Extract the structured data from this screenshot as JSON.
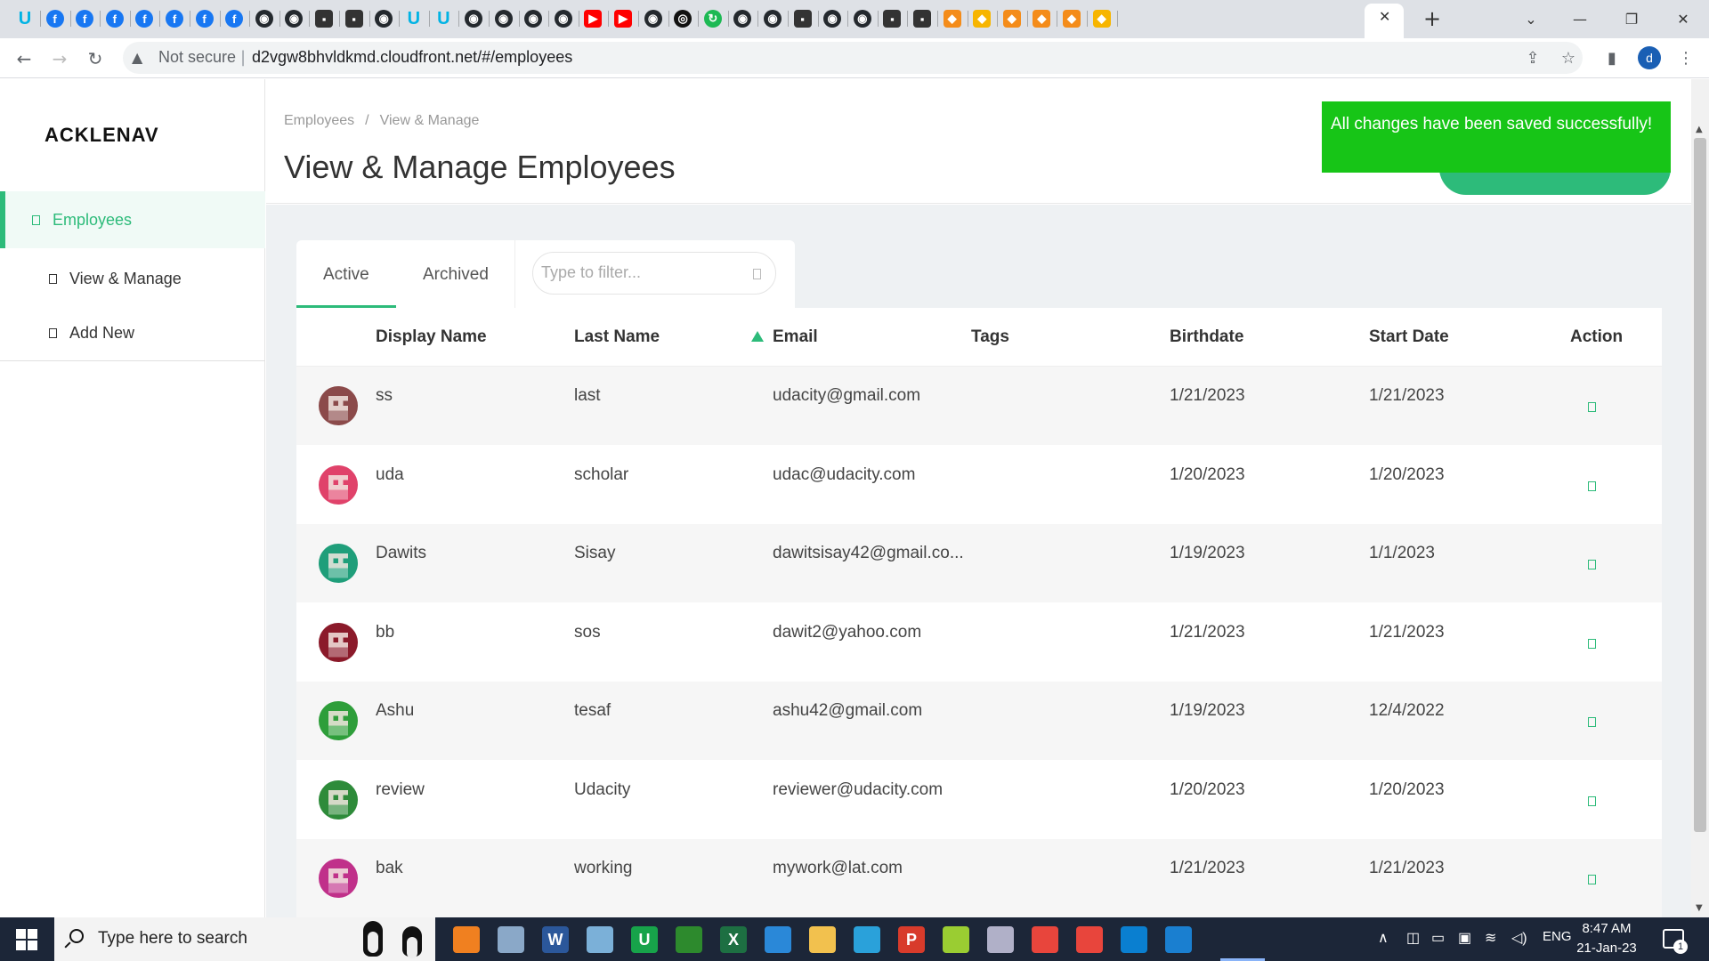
{
  "browser": {
    "address_warning": "Not secure",
    "url": "d2vgw8bhvldkmd.cloudfront.net/#/employees",
    "profile_initial": "d",
    "new_tab_label": "+",
    "close_tab_label": "✕",
    "pinned_tabs": [
      {
        "icon": "udacity-icon",
        "color": "#02b3e4"
      },
      {
        "icon": "facebook-icon",
        "color": "#1877f2"
      },
      {
        "icon": "facebook-icon",
        "color": "#1877f2"
      },
      {
        "icon": "facebook-icon",
        "color": "#1877f2"
      },
      {
        "icon": "facebook-icon",
        "color": "#1877f2"
      },
      {
        "icon": "facebook-icon",
        "color": "#1877f2"
      },
      {
        "icon": "facebook-icon",
        "color": "#1877f2"
      },
      {
        "icon": "facebook-icon",
        "color": "#1877f2"
      },
      {
        "icon": "github-icon",
        "color": "#24292e"
      },
      {
        "icon": "github-icon",
        "color": "#24292e"
      },
      {
        "icon": "terminal-icon",
        "color": "#333333"
      },
      {
        "icon": "terminal-icon",
        "color": "#333333"
      },
      {
        "icon": "github-icon",
        "color": "#24292e"
      },
      {
        "icon": "udacity-icon",
        "color": "#02b3e4"
      },
      {
        "icon": "udacity-icon",
        "color": "#02b3e4"
      },
      {
        "icon": "github-icon",
        "color": "#24292e"
      },
      {
        "icon": "github-icon",
        "color": "#24292e"
      },
      {
        "icon": "github-icon",
        "color": "#24292e"
      },
      {
        "icon": "github-icon",
        "color": "#24292e"
      },
      {
        "icon": "youtube-icon",
        "color": "#ff0000"
      },
      {
        "icon": "youtube-icon",
        "color": "#ff0000"
      },
      {
        "icon": "github-icon",
        "color": "#24292e"
      },
      {
        "icon": "circle-logo-icon",
        "color": "#111111"
      },
      {
        "icon": "green-circle-icon",
        "color": "#1db954"
      },
      {
        "icon": "github-icon",
        "color": "#24292e"
      },
      {
        "icon": "github-icon",
        "color": "#24292e"
      },
      {
        "icon": "terminal-icon",
        "color": "#333333"
      },
      {
        "icon": "github-icon",
        "color": "#24292e"
      },
      {
        "icon": "github-icon",
        "color": "#24292e"
      },
      {
        "icon": "terminal-icon",
        "color": "#333333"
      },
      {
        "icon": "terminal-icon",
        "color": "#333333"
      },
      {
        "icon": "aws-cube-icon",
        "color": "#f48c1a"
      },
      {
        "icon": "aws-box-icon",
        "color": "#f7b500"
      },
      {
        "icon": "aws-cube-icon",
        "color": "#f48c1a"
      },
      {
        "icon": "aws-cube-icon",
        "color": "#f48c1a"
      },
      {
        "icon": "aws-cube-icon",
        "color": "#f48c1a"
      },
      {
        "icon": "aws-box-icon",
        "color": "#f7b500"
      }
    ]
  },
  "app": {
    "logo": "ACKLENAV",
    "accent": "#2dbb7a",
    "sidebar": {
      "items": [
        {
          "label": "Employees",
          "active": true
        },
        {
          "label": "View & Manage",
          "active": false
        },
        {
          "label": "Add New",
          "active": false
        }
      ]
    },
    "breadcrumb": {
      "root": "Employees",
      "separator": "/",
      "current": "View & Manage"
    },
    "page_title": "View & Manage Employees",
    "toast": {
      "message": "All changes have been saved successfully!",
      "color": "#17c517"
    },
    "tabs": [
      {
        "label": "Active",
        "selected": true
      },
      {
        "label": "Archived",
        "selected": false
      }
    ],
    "filter": {
      "placeholder": "Type to filter..."
    },
    "table": {
      "columns": [
        "Display Name",
        "Last Name",
        "Email",
        "Tags",
        "Birthdate",
        "Start Date",
        "Action"
      ],
      "sorted_column": "Email",
      "rows": [
        {
          "display_name": "ss",
          "last_name": "last",
          "email": "udacity@gmail.com",
          "tags": "",
          "birthdate": "1/21/2023",
          "start_date": "1/21/2023",
          "avatar_color": "#8b4a4a"
        },
        {
          "display_name": "uda",
          "last_name": "scholar",
          "email": "udac@udacity.com",
          "tags": "",
          "birthdate": "1/20/2023",
          "start_date": "1/20/2023",
          "avatar_color": "#e0426a"
        },
        {
          "display_name": "Dawits",
          "last_name": "Sisay",
          "email": "dawitsisay42@gmail.co...",
          "tags": "",
          "birthdate": "1/19/2023",
          "start_date": "1/1/2023",
          "avatar_color": "#1f9e7a"
        },
        {
          "display_name": "bb",
          "last_name": "sos",
          "email": "dawit2@yahoo.com",
          "tags": "",
          "birthdate": "1/21/2023",
          "start_date": "1/21/2023",
          "avatar_color": "#8b1a2a"
        },
        {
          "display_name": "Ashu",
          "last_name": "tesaf",
          "email": "ashu42@gmail.com",
          "tags": "",
          "birthdate": "1/19/2023",
          "start_date": "12/4/2022",
          "avatar_color": "#2e9e3a"
        },
        {
          "display_name": "review",
          "last_name": "Udacity",
          "email": "reviewer@udacity.com",
          "tags": "",
          "birthdate": "1/20/2023",
          "start_date": "1/20/2023",
          "avatar_color": "#2e8b3a"
        },
        {
          "display_name": "bak",
          "last_name": "working",
          "email": "mywork@lat.com",
          "tags": "",
          "birthdate": "1/21/2023",
          "start_date": "1/21/2023",
          "avatar_color": "#c0308a"
        }
      ]
    }
  },
  "taskbar": {
    "search_placeholder": "Type here to search",
    "language": "ENG",
    "time": "8:47 AM",
    "date": "21-Jan-23",
    "notification_count": "1",
    "apps": [
      {
        "icon": "search-app-icon",
        "color": "#f08020",
        "label": ""
      },
      {
        "icon": "hp-app-icon",
        "color": "#8aa8c8",
        "label": ""
      },
      {
        "icon": "word-icon",
        "color": "#2b579a",
        "label": "W"
      },
      {
        "icon": "notepad-icon",
        "color": "#7bb0d8",
        "label": ""
      },
      {
        "icon": "udacity-app-icon",
        "color": "#17a34a",
        "label": "U"
      },
      {
        "icon": "ie-app-icon",
        "color": "#2d8a2d",
        "label": ""
      },
      {
        "icon": "excel-icon",
        "color": "#1d6f42",
        "label": "X"
      },
      {
        "icon": "camera-app-icon",
        "color": "#2a88d8",
        "label": ""
      },
      {
        "icon": "file-explorer-icon",
        "color": "#f2c14e",
        "label": ""
      },
      {
        "icon": "telegram-icon",
        "color": "#2aa1da",
        "label": ""
      },
      {
        "icon": "p-app-icon",
        "color": "#d83b2b",
        "label": "P"
      },
      {
        "icon": "green-app-icon",
        "color": "#9acd32",
        "label": ""
      },
      {
        "icon": "paint-icon",
        "color": "#b0b0c8",
        "label": ""
      },
      {
        "icon": "chrome-icon",
        "color": "#e8453c",
        "label": ""
      },
      {
        "icon": "chrome-icon",
        "color": "#e8453c",
        "label": ""
      },
      {
        "icon": "vscode-icon",
        "color": "#0a7fd0",
        "label": ""
      },
      {
        "icon": "photos-icon",
        "color": "#1a7fd0",
        "label": ""
      }
    ]
  }
}
